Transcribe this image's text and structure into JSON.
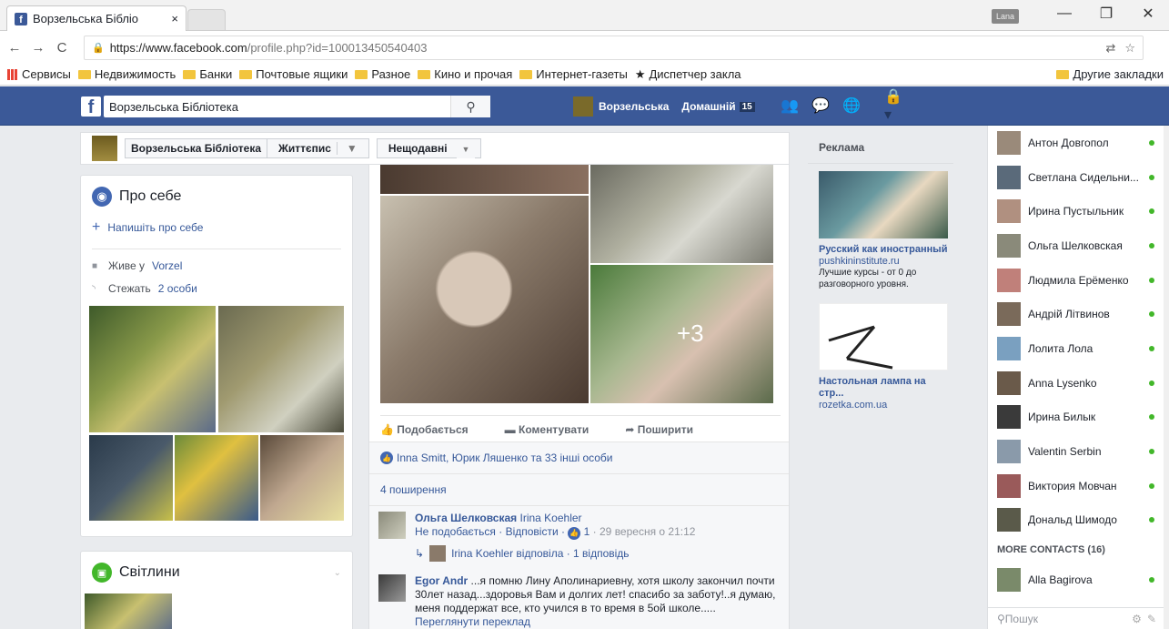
{
  "browser": {
    "tab_title": "Ворзельська Бібліо",
    "tab_close": "×",
    "user_badge": "Lana",
    "url_host": "https://www.facebook.com",
    "url_path": "/profile.php?id=100013450540403",
    "bookmarks": [
      "Сервисы",
      "Недвижимость",
      "Банки",
      "Почтовые ящики",
      "Разное",
      "Кино и прочая",
      "Интернет-газеты",
      "Диспетчер закла"
    ],
    "other_bookmarks": "Другие закладки"
  },
  "fb": {
    "search_value": "Ворзельська Бібліотека",
    "profile_name": "Ворзельська",
    "home_label": "Домашній",
    "home_count": "15",
    "colors": {
      "brand": "#3b5998",
      "link": "#365899",
      "online": "#42b72a"
    }
  },
  "profile_bar": {
    "name": "Ворзельська Бібліотека",
    "timeline": "Життєпис",
    "recent": "Нещодавні"
  },
  "about": {
    "title": "Про себе",
    "add": "Напишіть про себе",
    "lives_prefix": "Живе у",
    "lives_place": "Vorzel",
    "follows_prefix": "Стежать",
    "follows_count": "2 особи"
  },
  "photos": {
    "title": "Світлини"
  },
  "post": {
    "more_photos": "+3",
    "like": "Подобається",
    "comment": "Коментувати",
    "share": "Поширити",
    "reactions": "Inna Smitt, Юрик Ляшенко та 33 інші особи",
    "shares": "4 поширення",
    "comments": [
      {
        "author": "Ольга Шелковская",
        "tag": "Irina Koehler",
        "text": "",
        "meta": "Не подобається · Відповісти · ",
        "likes": "1",
        "time": " · 29 вересня о 21:12"
      },
      {
        "author": "Egor Andr",
        "text": " ...я помню Лину Аполинариевну, хотя школу закончил почти 30лет назад...здоровья Вам и долгих лет! спасибо за заботу!..я думаю, меня поддержат все, кто учился в то время в 5ой школе.....",
        "translate": "Переглянути переклад"
      }
    ],
    "reply": "Irina Koehler відповіла · 1 відповідь"
  },
  "ads": {
    "title": "Реклама",
    "items": [
      {
        "title": "Русский как иностранный",
        "domain": "pushkininstitute.ru",
        "desc": "Лучшие курсы - от 0 до разговорного уровня."
      },
      {
        "title": "Настольная лампа на стр...",
        "domain": "rozetka.com.ua",
        "desc": ""
      }
    ]
  },
  "chat": {
    "contacts": [
      "Антон Довгопол",
      "Светлана Сидельни...",
      "Ирина Пустыльник",
      "Ольга Шелковская",
      "Людмила Ерёменко",
      "Андрій Літвинов",
      "Лолита Лола",
      "Anna Lysenko",
      "Ирина Билык",
      "Valentin Serbin",
      "Виктория Мовчан",
      "Дональд Шимодо"
    ],
    "more": "MORE CONTACTS (16)",
    "more_contacts": [
      "Alla Bagirova"
    ],
    "search_placeholder": "Пошук"
  }
}
